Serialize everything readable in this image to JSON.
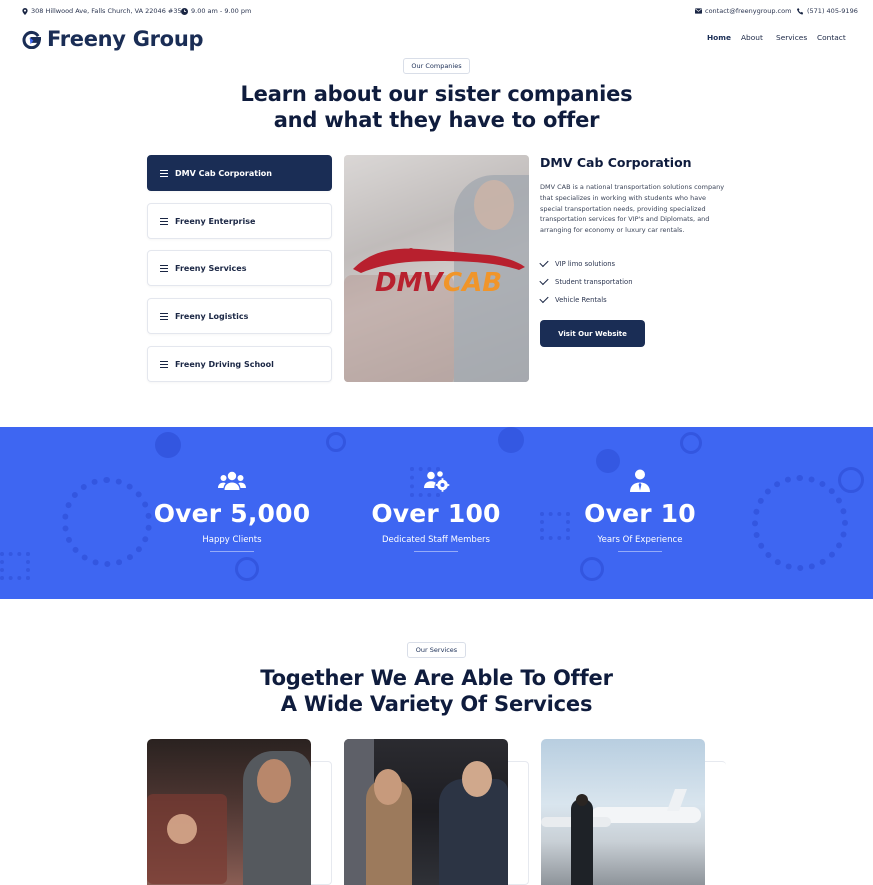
{
  "topbar": {
    "address": "308 Hillwood Ave, Falls Church, VA 22046 #350",
    "hours": "9.00 am - 9.00 pm",
    "email": "contact@freenygroup.com",
    "phone": "(571) 405-9196"
  },
  "header": {
    "logo_text": "Freeny Group",
    "nav": [
      "Home",
      "About",
      "Services",
      "Contact"
    ]
  },
  "companies": {
    "pill": "Our Companies",
    "title_line1": "Learn about our sister companies",
    "title_line2": "and what they have to offer",
    "tabs": [
      "DMV Cab Corporation",
      "Freeny Enterprise",
      "Freeny Services",
      "Freeny Logistics",
      "Freeny Driving School"
    ],
    "active": {
      "title": "DMV Cab Corporation",
      "description": "DMV CAB is a national transportation solutions company that specializes in working with students who have special transportation needs, providing specialized transportation services for VIP's and Diplomats, and arranging for economy or luxury car rentals.",
      "features": [
        "VIP limo solutions",
        "Student transportation",
        "Vehicle Rentals"
      ],
      "button": "Visit Our Website",
      "logo_word1": "DMV",
      "logo_word2": "CAB"
    }
  },
  "stats": [
    {
      "number": "Over 5,000",
      "label": "Happy Clients",
      "icon": "users-icon"
    },
    {
      "number": "Over 100",
      "label": "Dedicated Staff Members",
      "icon": "users-gear-icon"
    },
    {
      "number": "Over 10",
      "label": "Years Of Experience",
      "icon": "user-tie-icon"
    }
  ],
  "services": {
    "pill": "Our Services",
    "title_line1": "Together We Are Able To Offer",
    "title_line2": "A Wide Variety Of Services"
  },
  "colors": {
    "navy": "#1a2d55",
    "blue_band": "#3e66f2",
    "logo_red": "#b8202e",
    "logo_orange": "#f0952a"
  }
}
